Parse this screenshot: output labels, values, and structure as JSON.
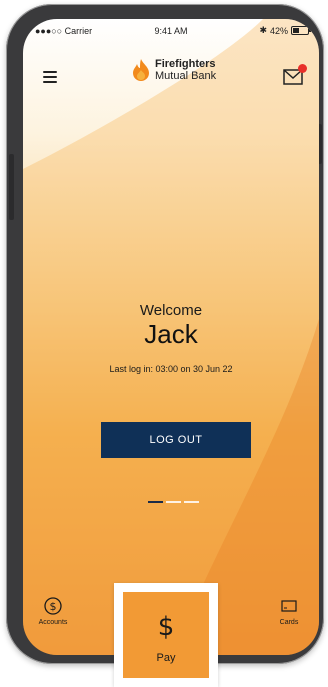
{
  "status_bar": {
    "carrier": "●●●○○ Carrier",
    "time": "9:41 AM",
    "battery": "42%",
    "battery_level": 0.42
  },
  "header": {
    "brand_name": "Firefighters",
    "brand_sub": "Mutual Bank",
    "has_unread_messages": true
  },
  "main": {
    "welcome": "Welcome",
    "user_name": "Jack",
    "last_login": "Last log in: 03:00 on 30 Jun 22",
    "logout_label": "LOG OUT",
    "pager": {
      "count": 3,
      "active_index": 0
    }
  },
  "tab_bar": {
    "accounts_label": "Accounts",
    "pay_label": "Pay",
    "pay_symbol": "$",
    "cards_label": "Cards"
  },
  "colors": {
    "navy": "#0f3057",
    "orange": "#f29a35",
    "notification_red": "#e8302a"
  }
}
